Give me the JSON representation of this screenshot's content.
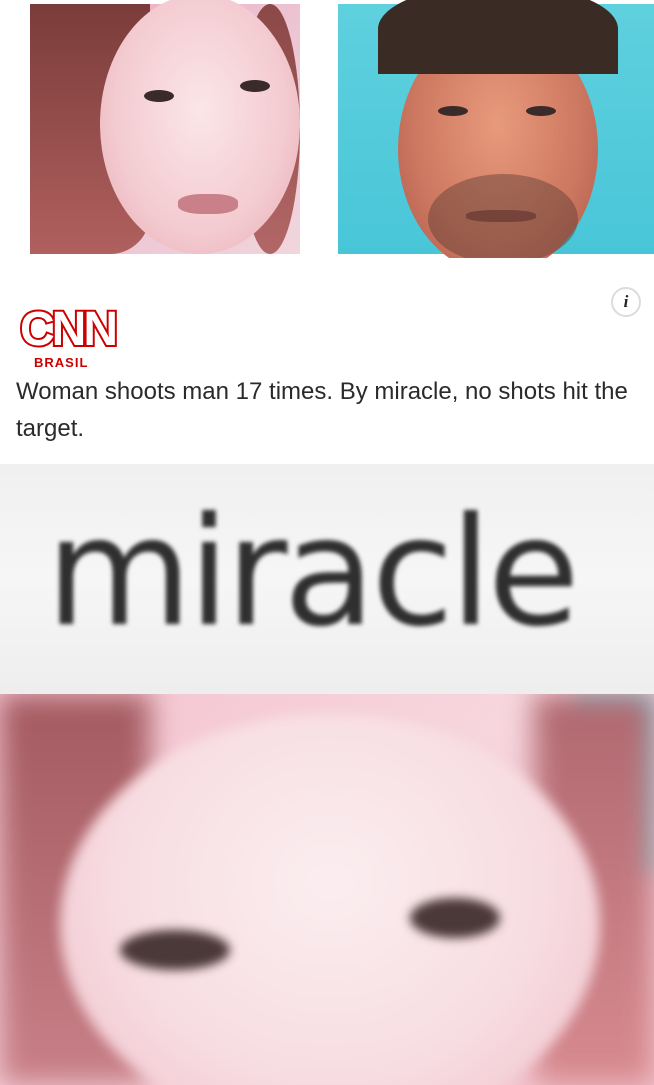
{
  "top_photos": {
    "left_photo": "woman-portrait",
    "right_photo": "man-portrait"
  },
  "news_card": {
    "info_icon_glyph": "i",
    "logo_wordmark": "CNN",
    "logo_subtitle": "BRASIL",
    "headline": "Woman shoots man 17 times. By miracle, no shots hit the target."
  },
  "zoom_word": "miracle",
  "closeup_photo": "woman-eyes-closeup",
  "colors": {
    "cnn_red": "#cc0000",
    "pink_background": "#f3a2be",
    "teal_background": "#48c6d8"
  }
}
